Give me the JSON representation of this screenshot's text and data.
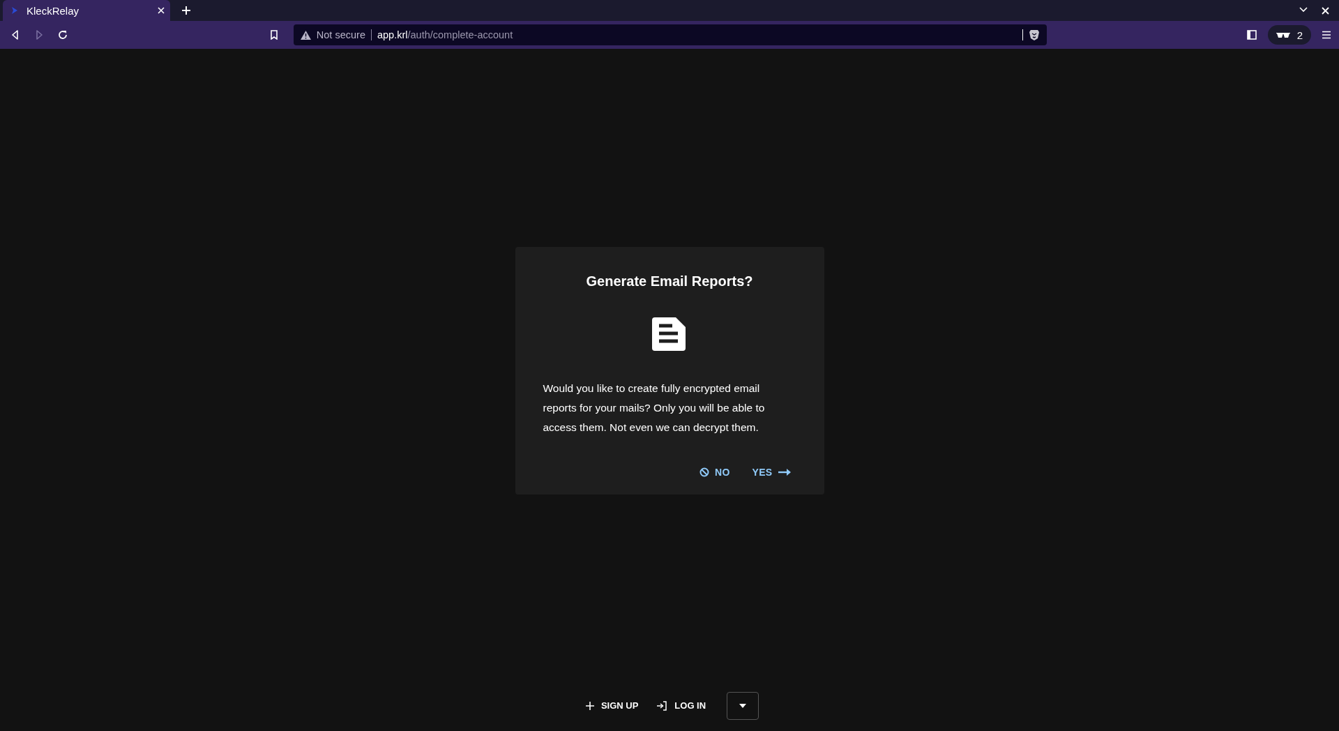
{
  "browser": {
    "tab_title": "KleckRelay",
    "nav_buttons": [
      {
        "kind": "back",
        "disabled": false
      },
      {
        "kind": "forward",
        "disabled": true
      },
      {
        "kind": "reload",
        "disabled": false
      }
    ],
    "security_label": "Not secure",
    "url_host": "app.krl",
    "url_path": "/auth/complete-account",
    "shields_count": "2"
  },
  "dialog": {
    "title": "Generate Email Reports?",
    "body": "Would you like to create fully encrypted email reports for your mails? Only you will be able to access them. Not even we can decrypt them.",
    "buttons": [
      {
        "kind": "no",
        "label": "NO"
      },
      {
        "kind": "yes",
        "label": "YES"
      }
    ]
  },
  "footer": {
    "actions": [
      {
        "kind": "signup",
        "label": "SIGN UP"
      },
      {
        "kind": "login",
        "label": "LOG IN"
      }
    ]
  }
}
